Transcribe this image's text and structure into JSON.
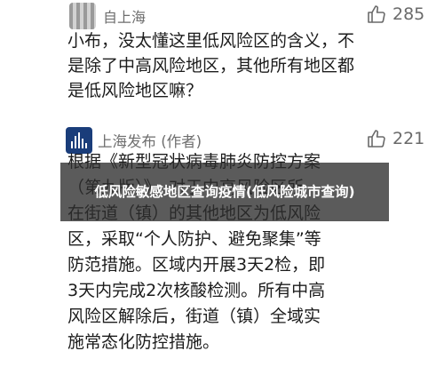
{
  "comments": [
    {
      "username": "自上海",
      "likes": "285",
      "text": "小布，没太懂这里低风险区的含义，不\n是除了中高风险地区，其他所有地区都\n是低风险地区嘛？"
    },
    {
      "username": "上海发布 (作者)",
      "likes": "221",
      "text": "根据《新型冠状病毒肺炎防控方案\n（第九版）》，对于中高风险区所\n在街道（镇）的其他地区为低风险\n区，采取“个人防护、避免聚集”等\n防范措施。区域内开展3天2检，即\n3天内完成2次核酸检测。所有中高\n风险区解除后，街道（镇）全域实\n施常态化防控措施。"
    }
  ],
  "overlay": {
    "title": "低风险敏感地区查询疫情(低风险城市查询)"
  },
  "icons": {
    "like": "thumbs-up-icon",
    "avatar_1": "blurred-avatar",
    "avatar_2": "shanghai-release-avatar"
  },
  "colors": {
    "avatar_2": "#1a3d7a",
    "overlay": "#2d2d2d"
  }
}
